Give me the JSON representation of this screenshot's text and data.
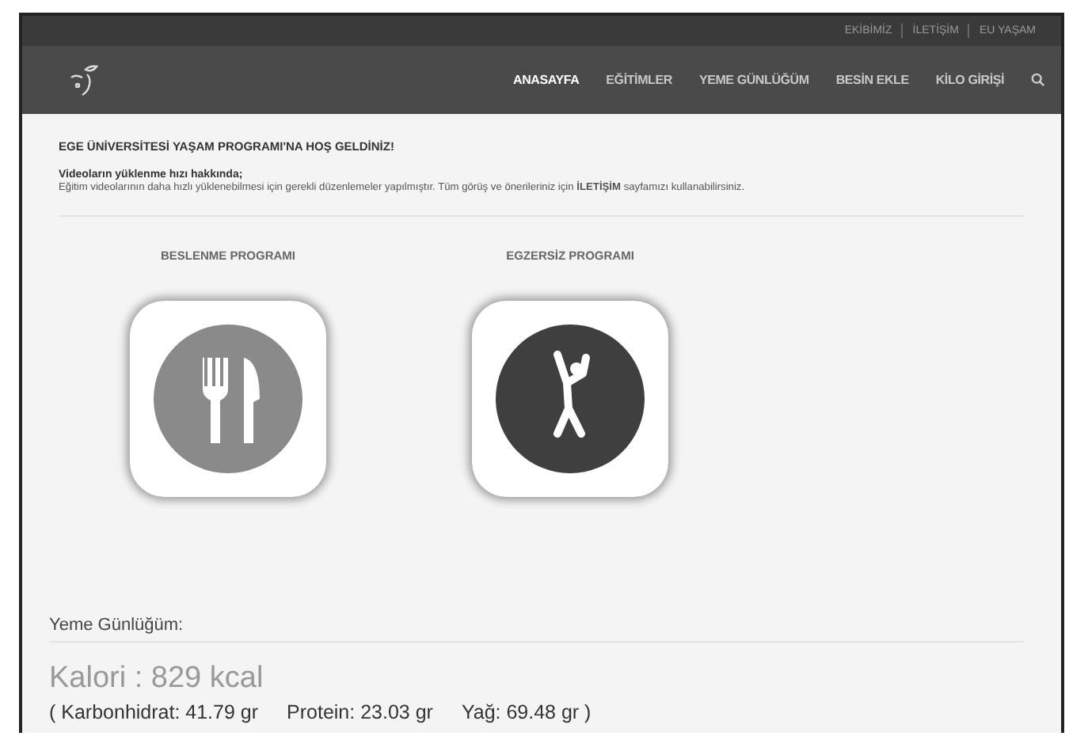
{
  "top_links": [
    {
      "label": "EKİBİMİZ"
    },
    {
      "label": "İLETİŞİM"
    },
    {
      "label": "EU YAŞAM"
    }
  ],
  "nav": [
    {
      "label": "ANASAYFA",
      "selected": true
    },
    {
      "label": "EĞİTİMLER",
      "selected": false
    },
    {
      "label": "YEME GÜNLÜĞÜM",
      "selected": false
    },
    {
      "label": "BESİN EKLE",
      "selected": false
    },
    {
      "label": "KİLO GİRİŞİ",
      "selected": false
    }
  ],
  "welcome": "EGE ÜNİVERSİTESİ YAŞAM PROGRAMI'NA HOŞ GELDİNİZ!",
  "notice_title": "Videoların yüklenme hızı hakkında;",
  "notice_text": "Eğitim videolarının daha hızlı yüklenebilmesi için gerekli düzenlemeler yapılmıştır. Tüm görüş ve önerileriniz için **İLETİŞİM** sayfamızı kullanabilirsiniz.",
  "programs": [
    {
      "label": "BESLENME PROGRAMI",
      "kind": "nutrition"
    },
    {
      "label": "EGZERSİZ PROGRAMI",
      "kind": "exercise"
    }
  ],
  "diary": {
    "title": "Yeme Günlüğüm:",
    "calories": "Kalori : 829 kcal",
    "macros": [
      "( Karbonhidrat: 41.79 gr",
      "Protein: 23.03 gr",
      "Yağ: 69.48 gr )"
    ]
  }
}
